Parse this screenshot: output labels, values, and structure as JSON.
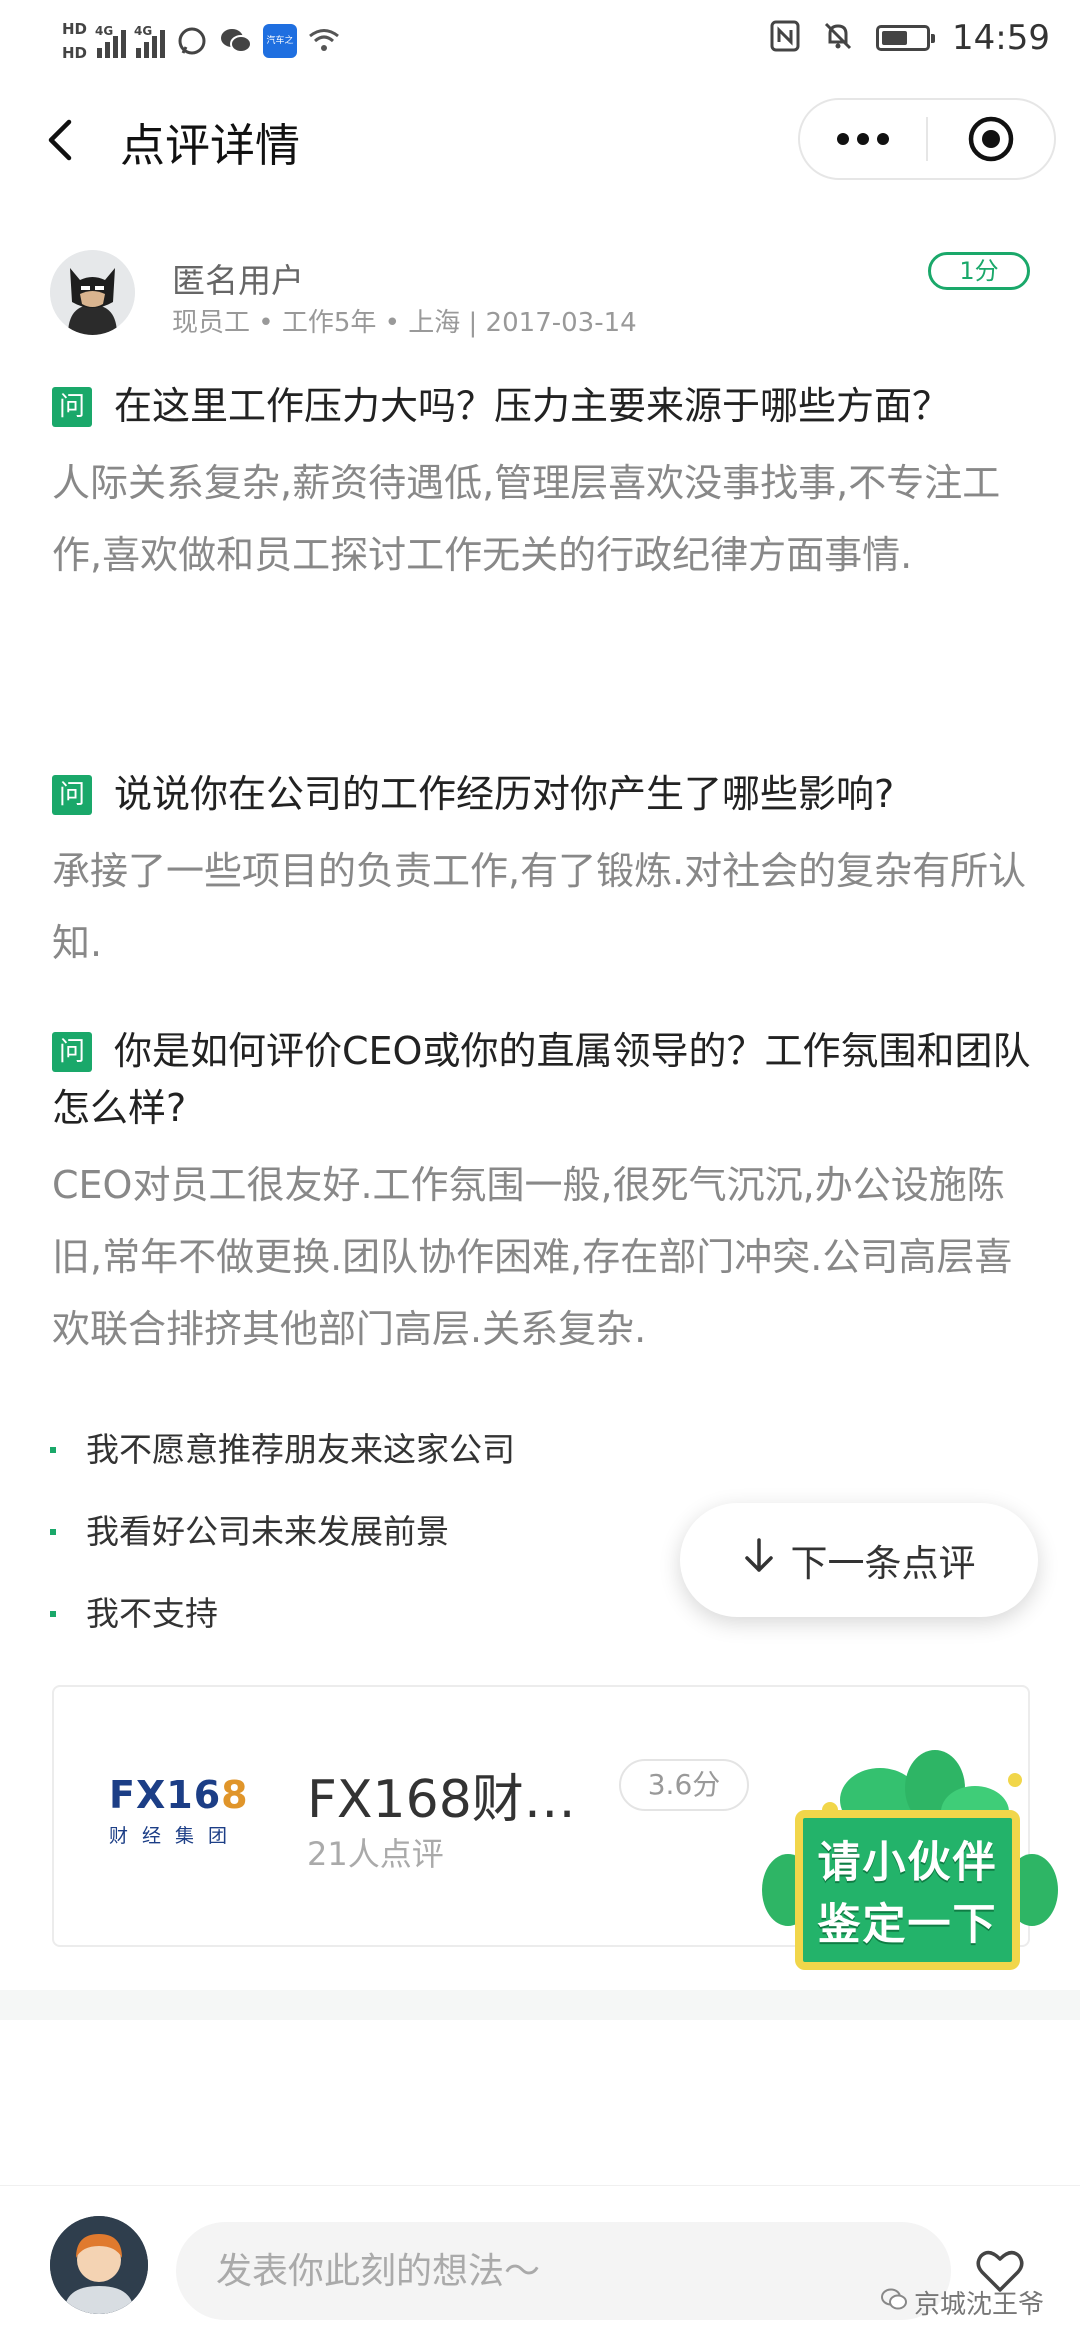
{
  "status_bar": {
    "hd1": "HD",
    "hd2": "HD",
    "net1": "4G",
    "net2": "4G",
    "app_badge": "汽车之家",
    "time": "14:59",
    "battery_level": 0.6,
    "icons": [
      "signal-icon",
      "wechat-icon",
      "nfc-icon",
      "mute-icon",
      "wifi-icon",
      "battery-icon"
    ]
  },
  "nav": {
    "title": "点评详情",
    "back_icon": "chevron-left-icon",
    "more_icon": "more-dots-icon",
    "close_icon": "target-icon"
  },
  "review": {
    "user_name": "匿名用户",
    "user_meta": "现员工 • 工作5年 • 上海 | 2017-03-14",
    "score": "1分",
    "q_tag": "问",
    "qa": [
      {
        "question": "在这里工作压力大吗？压力主要来源于哪些方面？",
        "answer": "人际关系复杂,薪资待遇低,管理层喜欢没事找事,不专注工作,喜欢做和员工探讨工作无关的行政纪律方面事情."
      },
      {
        "question": "说说你在公司的工作经历对你产生了哪些影响?",
        "answer": "承接了一些项目的负责工作,有了锻炼.对社会的复杂有所认知."
      },
      {
        "question": "你是如何评价CEO或你的直属领导的？工作氛围和团队怎么样?",
        "answer": "CEO对员工很友好.工作氛围一般,很死气沉沉,办公设施陈旧,常年不做更换.团队协作困难,存在部门冲突.公司高层喜欢联合排挤其他部门高层.关系复杂."
      }
    ],
    "bullets": [
      "我不愿意推荐朋友来这家公司",
      "我看好公司未来发展前景",
      "我不支持"
    ]
  },
  "next_button": {
    "label": "下一条点评",
    "icon": "arrow-down-icon"
  },
  "company": {
    "logo_text_a": "FX16",
    "logo_text_b": "8",
    "logo_sub": "财经集团",
    "name": "FX168财…",
    "score": "3.6分",
    "review_count": "21人点评"
  },
  "sticker": {
    "line1": "请小伙伴",
    "line2": "鉴定一下"
  },
  "bottom": {
    "placeholder": "发表你此刻的想法～",
    "heart_icon": "heart-icon",
    "watermark": "京城沈王爷"
  },
  "colors": {
    "accent_green": "#1aa86a",
    "sticker_green": "#23b36a",
    "sticker_border": "#f1d64a",
    "logo_blue": "#1c3e86",
    "logo_orange": "#e0952a"
  }
}
